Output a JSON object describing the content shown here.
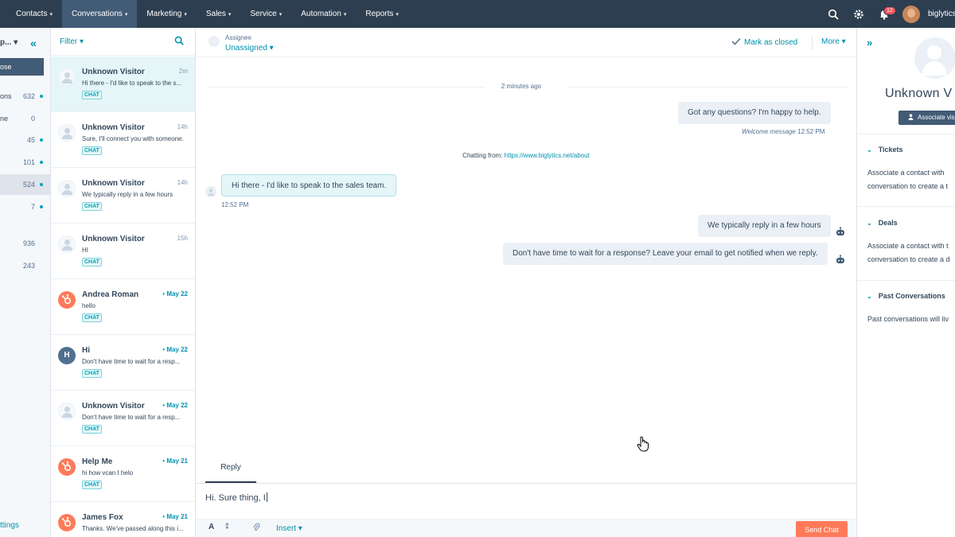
{
  "topnav": {
    "items": [
      {
        "label": "Contacts"
      },
      {
        "label": "Conversations"
      },
      {
        "label": "Marketing"
      },
      {
        "label": "Sales"
      },
      {
        "label": "Service"
      },
      {
        "label": "Automation"
      },
      {
        "label": "Reports"
      }
    ],
    "notification_count": "12",
    "portal_name": "biglytics"
  },
  "inbox": {
    "title": "p...",
    "compose_label": "ose",
    "rows": [
      {
        "label": "ons",
        "count": "632",
        "dot": true
      },
      {
        "label": "ne",
        "count": "0",
        "dot": false
      },
      {
        "label": "",
        "count": "45",
        "dot": true
      },
      {
        "label": "",
        "count": "101",
        "dot": true
      },
      {
        "label": "",
        "count": "524",
        "dot": true
      },
      {
        "label": "",
        "count": "7",
        "dot": true
      },
      {
        "label": "",
        "count": "936",
        "dot": false
      },
      {
        "label": "",
        "count": "243",
        "dot": false
      }
    ],
    "settings_label": "ttings"
  },
  "list": {
    "filter_label": "Filter",
    "conversations": [
      {
        "name": "Unknown Visitor",
        "time": "2m",
        "preview": "Hi there - I'd like to speak to the s...",
        "tag": "CHAT",
        "avatar": "ghost"
      },
      {
        "name": "Unknown Visitor",
        "time": "14h",
        "preview": "Sure, I'll connect you with someone.",
        "tag": "CHAT",
        "avatar": "ghost"
      },
      {
        "name": "Unknown Visitor",
        "time": "14h",
        "preview": "We typically reply in a few hours",
        "tag": "CHAT",
        "avatar": "ghost"
      },
      {
        "name": "Unknown Visitor",
        "time": "15h",
        "preview": "HI",
        "tag": "CHAT",
        "avatar": "ghost"
      },
      {
        "name": "Andrea Roman",
        "time": "May 22",
        "preview": "hello",
        "tag": "CHAT",
        "avatar": "hub"
      },
      {
        "name": "Hi",
        "time": "May 22",
        "preview": "Don't have time to wait for a resp...",
        "tag": "CHAT",
        "avatar": "letter",
        "letter": "H"
      },
      {
        "name": "Unknown Visitor",
        "time": "May 22",
        "preview": "Don't have time to wait for a resp...",
        "tag": "CHAT",
        "avatar": "ghost"
      },
      {
        "name": "Help Me",
        "time": "May 21",
        "preview": "hi how vcan I helo",
        "tag": "CHAT",
        "avatar": "hub"
      },
      {
        "name": "James Fox",
        "time": "May 21",
        "preview": "Thanks. We've passed along this i...",
        "tag": "CHAT",
        "avatar": "hub"
      }
    ]
  },
  "thread": {
    "assignee_label": "Assignee",
    "assignee_value": "Unassigned",
    "mark_closed": "Mark as closed",
    "more": "More",
    "time_separator": "2 minutes ago",
    "welcome_bubble": "Got any questions? I'm happy to help.",
    "welcome_meta": "Welcome message",
    "welcome_time": "12:52 PM",
    "chatting_from_label": "Chatting from:",
    "chatting_from_url": "https://www.biglytics.net/about",
    "visitor_bubble": "Hi there - I'd like to speak to the sales team.",
    "visitor_time": "12:52 PM",
    "bot_bubble_1": "We typically reply in a few hours",
    "bot_bubble_2": "Don't have time to wait for a response? Leave your email to get notified when we reply.",
    "reply_tab": "Reply",
    "composer_text": "Hi. Sure thing, I",
    "insert_label": "Insert",
    "send_label": "Send Chat"
  },
  "contact": {
    "name": "Unknown V",
    "associate_label": "Associate visi",
    "sections": [
      {
        "title": "Tickets",
        "body_1": "Associate a contact with",
        "body_2": "conversation to create a t"
      },
      {
        "title": "Deals",
        "body_1": "Associate a contact with t",
        "body_2": "conversation to create a d"
      },
      {
        "title": "Past Conversations",
        "body_1": "Past conversations will liv",
        "body_2": ""
      }
    ]
  },
  "colors": {
    "nav_bg": "#2d3e50",
    "accent": "#0091ae",
    "send_button": "#ff7a59",
    "selected_row": "#e5f5f8"
  }
}
